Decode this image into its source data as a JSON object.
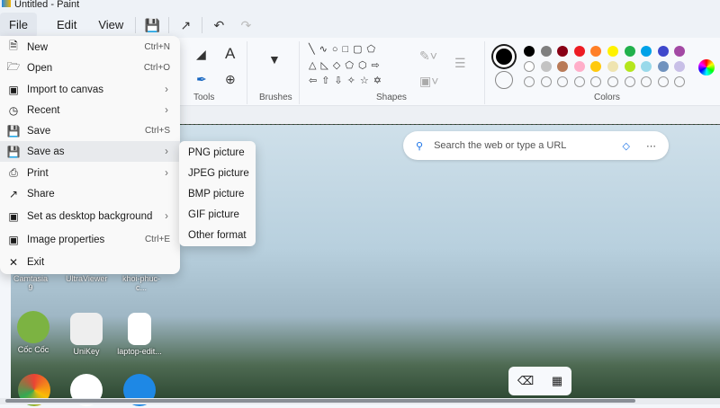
{
  "title": "Untitled - Paint",
  "menubar": {
    "file": "File",
    "edit": "Edit",
    "view": "View"
  },
  "ribbon": {
    "tools": "Tools",
    "brushes": "Brushes",
    "shapes": "Shapes",
    "colors": "Colors"
  },
  "file_menu": [
    {
      "label": "New",
      "shortcut": "Ctrl+N",
      "icon": "new-file-icon"
    },
    {
      "label": "Open",
      "shortcut": "Ctrl+O",
      "icon": "folder-icon"
    },
    {
      "label": "Import to canvas",
      "icon": "import-icon"
    },
    {
      "label": "Recent",
      "icon": "clock-icon"
    },
    {
      "label": "Save",
      "shortcut": "Ctrl+S",
      "icon": "save-icon"
    },
    {
      "label": "Save as",
      "icon": "save-as-icon"
    },
    {
      "label": "Print",
      "icon": "print-icon"
    },
    {
      "label": "Share",
      "icon": "share-icon"
    },
    {
      "label": "Set as desktop background",
      "icon": "desktop-icon"
    },
    {
      "label": "Image properties",
      "shortcut": "Ctrl+E",
      "icon": "image-icon"
    },
    {
      "label": "Exit",
      "icon": "close-icon"
    }
  ],
  "save_as_submenu": [
    "PNG picture",
    "JPEG picture",
    "BMP picture",
    "GIF picture",
    "Other format"
  ],
  "colors": {
    "row1": [
      "#000000",
      "#7f7f7f",
      "#880015",
      "#ed1c24",
      "#ff7f27",
      "#fff200",
      "#22b14c",
      "#00a2e8",
      "#3f48cc",
      "#a349a4"
    ],
    "row2": [
      "#ffffff",
      "#c3c3c3",
      "#b97a57",
      "#ffaec9",
      "#ffc90e",
      "#efe4b0",
      "#b5e61d",
      "#99d9ea",
      "#7092be",
      "#c8bfe7"
    ]
  },
  "canvas": {
    "search_placeholder": "Search the web or type a URL",
    "desktop_icons": [
      "Camtasia 9",
      "UltraViewer",
      "khoi-phuc-c...",
      "Cốc Cốc",
      "UniKey",
      "laptop-edit..."
    ]
  }
}
